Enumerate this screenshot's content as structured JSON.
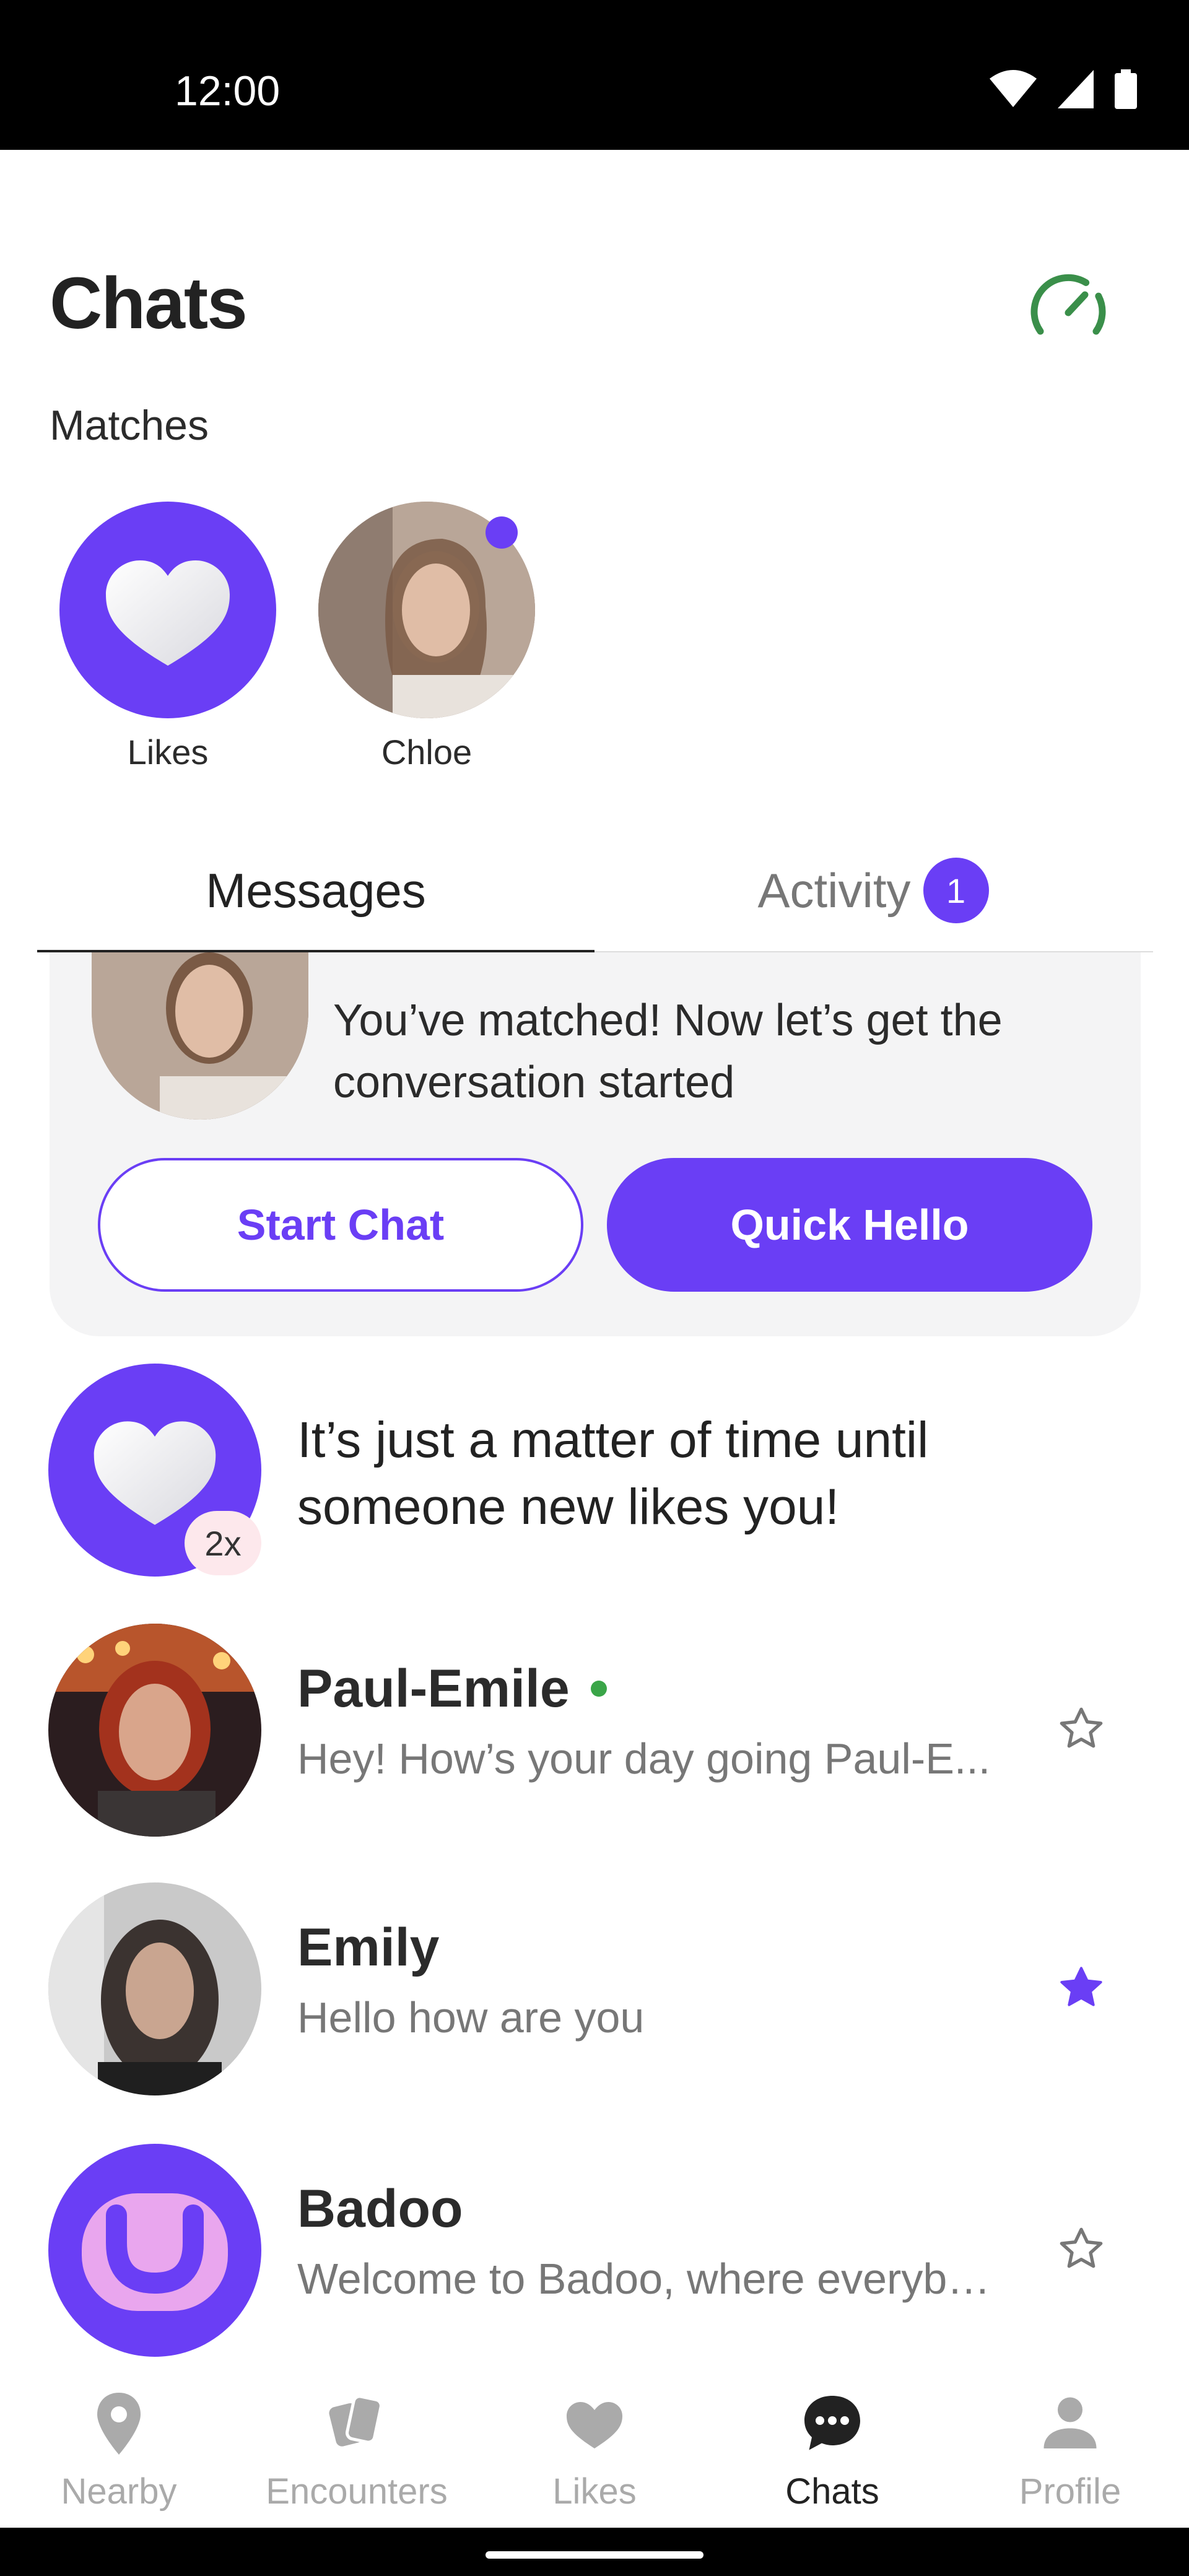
{
  "status_bar": {
    "time": "12:00"
  },
  "header": {
    "title": "Chats",
    "matches_label": "Matches"
  },
  "matches": [
    {
      "name": "Likes"
    },
    {
      "name": "Chloe"
    }
  ],
  "tabs": [
    {
      "label": "Messages",
      "active": true
    },
    {
      "label": "Activity",
      "badge": "1"
    }
  ],
  "match_card": {
    "message": "You’ve matched! Now let’s get the conversation started",
    "start_chat_label": "Start Chat",
    "quick_hello_label": "Quick Hello"
  },
  "likes_promo": {
    "message": "It’s just a matter of time until someone new likes you!",
    "multiplier": "2x"
  },
  "conversations": [
    {
      "name": "Paul-Emile",
      "message": "Hey! How’s your day going Paul-E...",
      "online": true,
      "starred": false
    },
    {
      "name": "Emily",
      "message": "Hello how are you",
      "starred": true
    },
    {
      "name": "Badoo",
      "message": "Welcome to Badoo, where everybo...",
      "starred": false
    }
  ],
  "bottom_nav": [
    {
      "label": "Nearby",
      "icon": "location-pin-icon"
    },
    {
      "label": "Encounters",
      "icon": "cards-icon"
    },
    {
      "label": "Likes",
      "icon": "heart-icon"
    },
    {
      "label": "Chats",
      "icon": "chat-bubble-icon",
      "active": true
    },
    {
      "label": "Profile",
      "icon": "profile-icon"
    }
  ],
  "colors": {
    "accent": "#6a3ef5",
    "online": "#3aa548",
    "speed": "#3a8f4a"
  }
}
